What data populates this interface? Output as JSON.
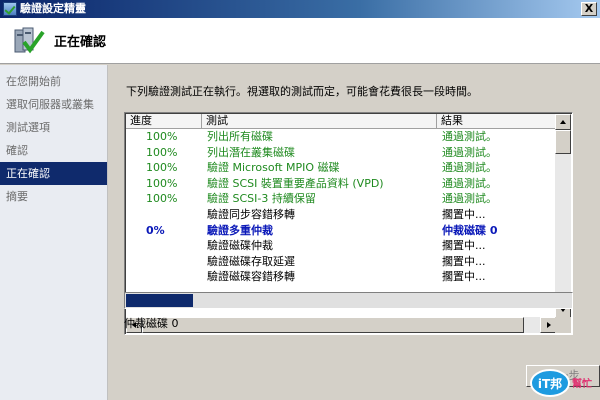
{
  "window": {
    "title": "驗證設定精靈",
    "close_glyph": "X"
  },
  "header": {
    "title": "正在確認"
  },
  "sidebar": {
    "items": [
      {
        "label": "在您開始前",
        "active": false
      },
      {
        "label": "選取伺服器或叢集",
        "active": false
      },
      {
        "label": "測試選項",
        "active": false
      },
      {
        "label": "確認",
        "active": false
      },
      {
        "label": "正在確認",
        "active": true
      },
      {
        "label": "摘要",
        "active": false
      }
    ]
  },
  "main": {
    "description": "下列驗證測試正在執行。視選取的測試而定，可能會花費很長一段時間。",
    "columns": {
      "progress": "進度",
      "test": "測試",
      "result": "結果"
    },
    "rows": [
      {
        "progress": "100%",
        "test": "列出所有磁碟",
        "result": "通過測試。",
        "state": "done"
      },
      {
        "progress": "100%",
        "test": "列出潛在叢集磁碟",
        "result": "通過測試。",
        "state": "done"
      },
      {
        "progress": "100%",
        "test": "驗證 Microsoft MPIO 磁碟",
        "result": "通過測試。",
        "state": "done"
      },
      {
        "progress": "100%",
        "test": "驗證 SCSI 裝置重要產品資料 (VPD)",
        "result": "通過測試。",
        "state": "done"
      },
      {
        "progress": "100%",
        "test": "驗證 SCSI-3 持續保留",
        "result": "通過測試。",
        "state": "done"
      },
      {
        "progress": "",
        "test": "驗證同步容錯移轉",
        "result": "擱置中...",
        "state": "pending"
      },
      {
        "progress": "0%",
        "test": "驗證多重仲裁",
        "result": "仲裁磁碟 0",
        "state": "running"
      },
      {
        "progress": "",
        "test": "驗證磁碟仲裁",
        "result": "擱置中...",
        "state": "pending"
      },
      {
        "progress": "",
        "test": "驗證磁碟存取延遲",
        "result": "擱置中...",
        "state": "pending"
      },
      {
        "progress": "",
        "test": "驗證磁碟容錯移轉",
        "result": "擱置中...",
        "state": "pending"
      }
    ],
    "overall_progress_fraction": 0.15,
    "status_text": "仲裁磁碟 0",
    "next_button_label": "下一步"
  },
  "watermark": {
    "text_main": "iT邦",
    "text_sub": "幫忙"
  },
  "colors": {
    "accent": "#0f2a6c",
    "passed": "#1f8a1f",
    "running": "#0a18b8"
  }
}
